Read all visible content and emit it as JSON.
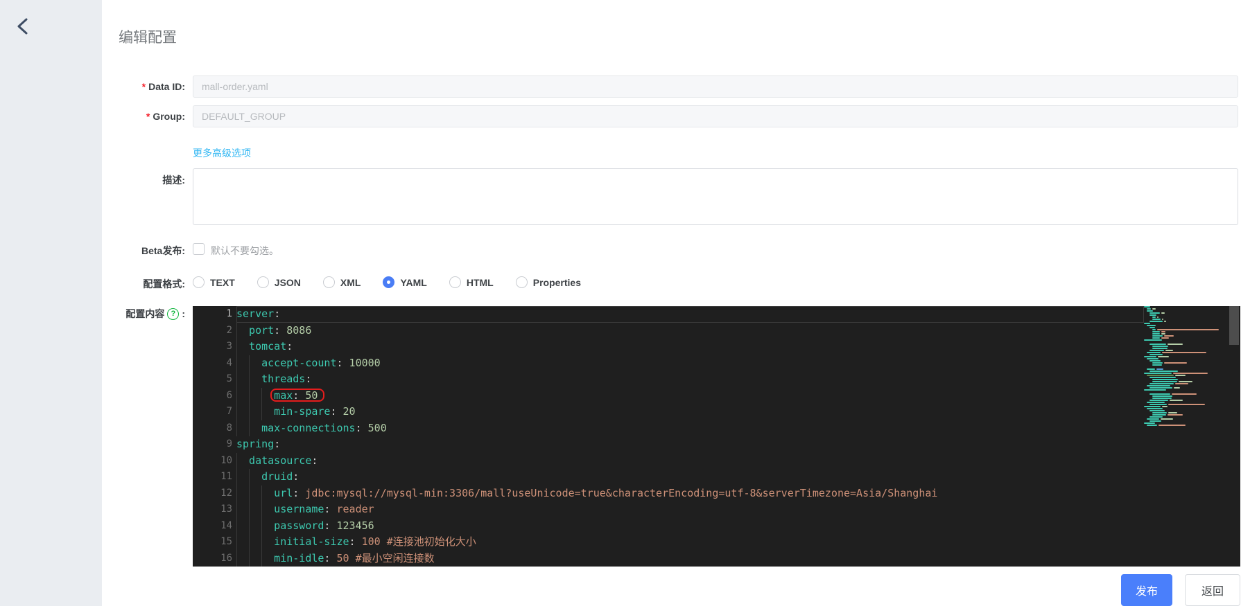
{
  "page": {
    "title": "编辑配置"
  },
  "sidebar": {
    "back_icon": "chevron-left"
  },
  "form": {
    "data_id": {
      "label": "Data ID:",
      "required": true,
      "value": "mall-order.yaml",
      "disabled": true
    },
    "group": {
      "label": "Group:",
      "required": true,
      "value": "DEFAULT_GROUP",
      "disabled": true
    },
    "advanced_link": "更多高级选项",
    "description": {
      "label": "描述:",
      "value": ""
    },
    "beta": {
      "label": "Beta发布:",
      "checked": false,
      "hint": "默认不要勾选。"
    },
    "format": {
      "label": "配置格式:",
      "options": [
        "TEXT",
        "JSON",
        "XML",
        "YAML",
        "HTML",
        "Properties"
      ],
      "selected": "YAML"
    },
    "content": {
      "label": "配置内容",
      "colon": ":",
      "help_icon": "question-circle-icon"
    }
  },
  "editor": {
    "language": "yaml",
    "active_line": 1,
    "annotation": {
      "line": 6,
      "text": "max: 50",
      "style": "red-box"
    },
    "lines": [
      {
        "num": 1,
        "indent": 0,
        "key": "server",
        "value": "",
        "value_type": "none"
      },
      {
        "num": 2,
        "indent": 2,
        "key": "port",
        "value": "8086",
        "value_type": "number"
      },
      {
        "num": 3,
        "indent": 2,
        "key": "tomcat",
        "value": "",
        "value_type": "none"
      },
      {
        "num": 4,
        "indent": 4,
        "key": "accept-count",
        "value": "10000",
        "value_type": "number"
      },
      {
        "num": 5,
        "indent": 4,
        "key": "threads",
        "value": "",
        "value_type": "none"
      },
      {
        "num": 6,
        "indent": 6,
        "key": "max",
        "value": "50",
        "value_type": "number",
        "annotated": true
      },
      {
        "num": 7,
        "indent": 6,
        "key": "min-spare",
        "value": "20",
        "value_type": "number"
      },
      {
        "num": 8,
        "indent": 4,
        "key": "max-connections",
        "value": "500",
        "value_type": "number"
      },
      {
        "num": 9,
        "indent": 0,
        "key": "spring",
        "value": "",
        "value_type": "none"
      },
      {
        "num": 10,
        "indent": 2,
        "key": "datasource",
        "value": "",
        "value_type": "none"
      },
      {
        "num": 11,
        "indent": 4,
        "key": "druid",
        "value": "",
        "value_type": "none"
      },
      {
        "num": 12,
        "indent": 6,
        "key": "url",
        "value": "jdbc:mysql://mysql-min:3306/mall?useUnicode=true&characterEncoding=utf-8&serverTimezone=Asia/Shanghai",
        "value_type": "string"
      },
      {
        "num": 13,
        "indent": 6,
        "key": "username",
        "value": "reader",
        "value_type": "string"
      },
      {
        "num": 14,
        "indent": 6,
        "key": "password",
        "value": "123456",
        "value_type": "number"
      },
      {
        "num": 15,
        "indent": 6,
        "key": "initial-size",
        "value": "100 #连接池初始化大小",
        "value_type": "string"
      },
      {
        "num": 16,
        "indent": 6,
        "key": "min-idle",
        "value": "50 #最小空闲连接数",
        "value_type": "string"
      }
    ]
  },
  "actions": {
    "publish": "发布",
    "back": "返回"
  },
  "colors": {
    "accent": "#4a7ffb",
    "link": "#2fb6f3",
    "radio_blue": "#4a7df5",
    "required": "#f5222d",
    "help_green": "#0fb53c",
    "annot": "#e51d1d",
    "ed_bg": "#1f1f1f",
    "ed_key": "#3dc9b0",
    "ed_num": "#b5cea8",
    "ed_str": "#ce9178",
    "back_arrow": "#3e4d64",
    "sidebar_bg": "#eaedf1"
  }
}
